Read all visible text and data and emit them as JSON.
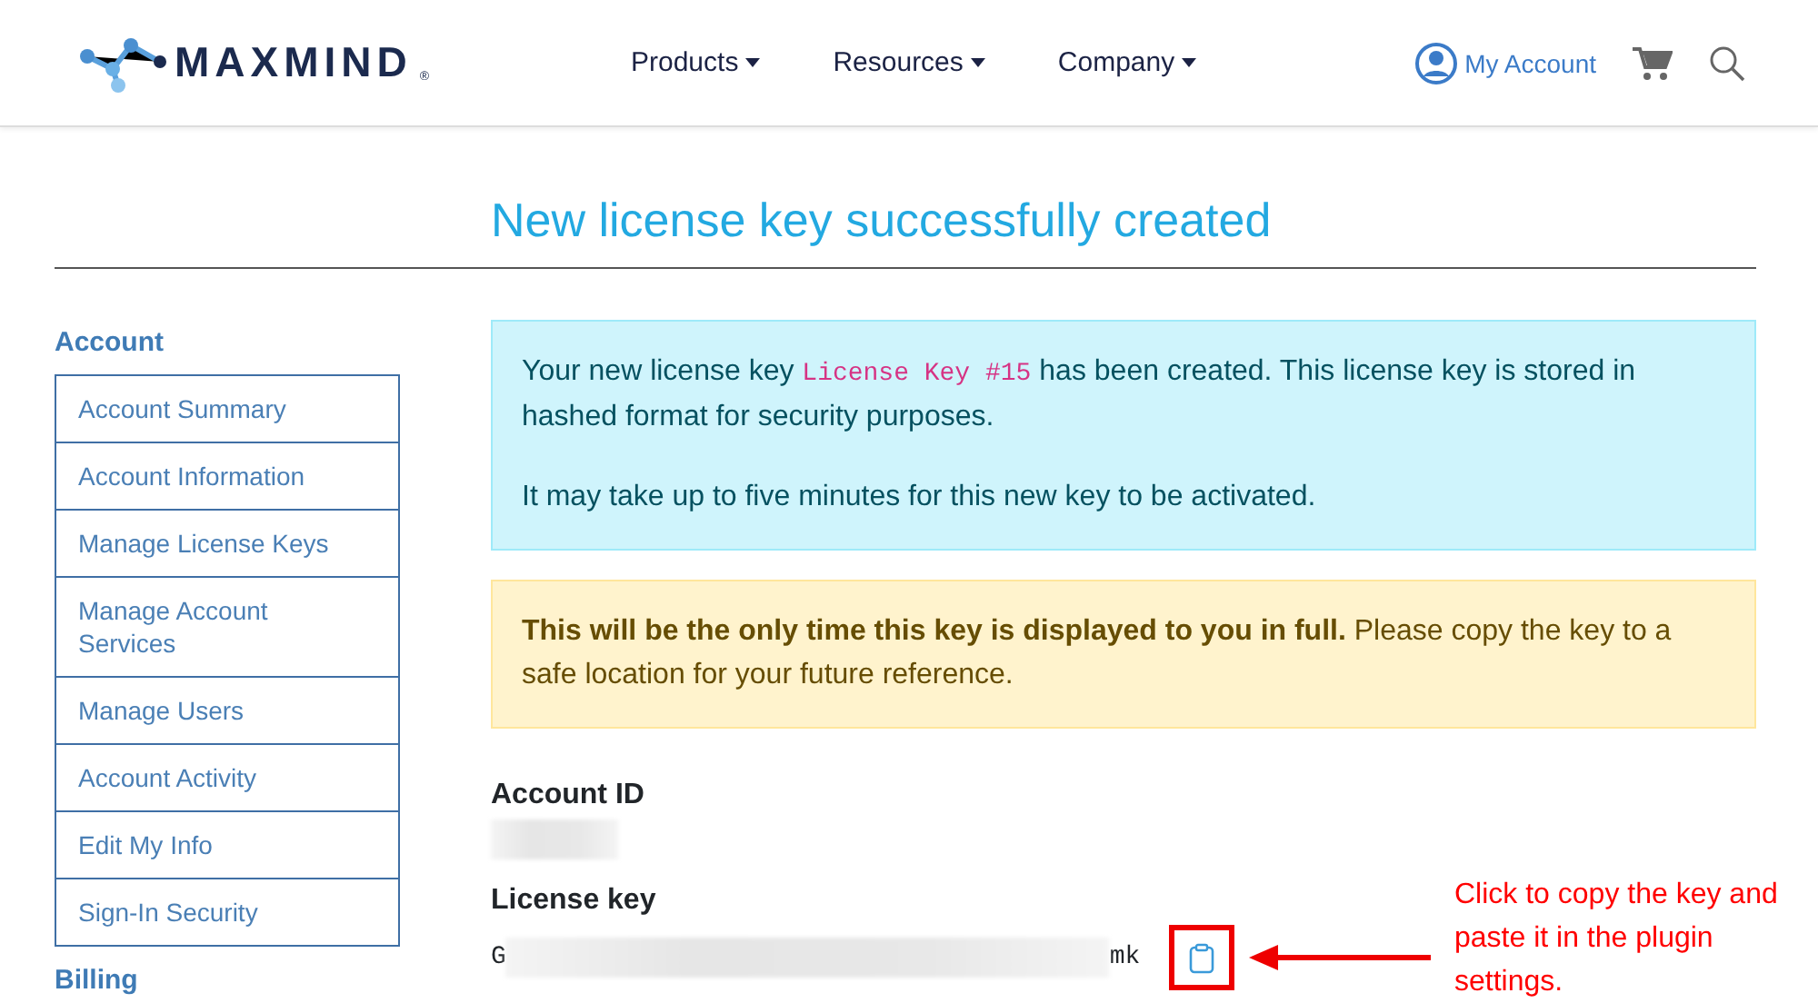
{
  "header": {
    "logo": "MAXMIND",
    "logo_mark": "®",
    "nav": [
      {
        "label": "Products"
      },
      {
        "label": "Resources"
      },
      {
        "label": "Company"
      }
    ],
    "account_link": "My Account"
  },
  "page_title": "New license key successfully created",
  "sidebar": {
    "sections": [
      {
        "heading": "Account",
        "items": [
          {
            "label": "Account Summary"
          },
          {
            "label": "Account Information"
          },
          {
            "label": "Manage License Keys"
          },
          {
            "label": "Manage Account Services"
          },
          {
            "label": "Manage Users"
          },
          {
            "label": "Account Activity"
          },
          {
            "label": "Edit My Info"
          },
          {
            "label": "Sign-In Security"
          }
        ]
      },
      {
        "heading": "Billing"
      }
    ]
  },
  "info_alert": {
    "before": "Your new license key",
    "code": "License Key #15",
    "after": "has been created. This license key is stored in hashed format for security purposes.",
    "note": "It may take up to five minutes for this new key to be activated."
  },
  "warning_alert": {
    "text": "**This will be the only time this key is displayed to you in full.** Please copy the key to a safe location for your future reference."
  },
  "fields": [
    {
      "label": "Account ID",
      "redacted": true
    },
    {
      "label": "License key",
      "prefix": "G",
      "suffix": "mk",
      "redacted": true,
      "copy_button": true
    }
  ],
  "annotation": {
    "text": "Click to copy the key and paste it in the plugin settings."
  }
}
